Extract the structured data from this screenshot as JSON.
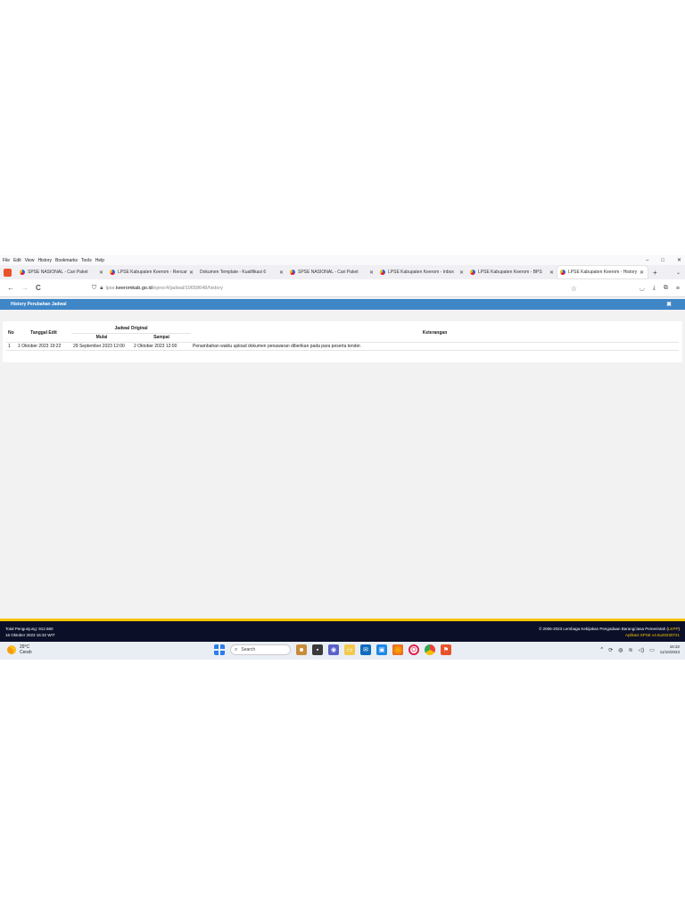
{
  "menubar": {
    "items": [
      "File",
      "Edit",
      "View",
      "History",
      "Bookmarks",
      "Tools",
      "Help"
    ]
  },
  "window_controls": {
    "minimize": "–",
    "maximize": "□",
    "close": "✕"
  },
  "tabs": [
    {
      "title": "SPSE NASIONAL - Cari Paket"
    },
    {
      "title": "LPSE Kabupaten Keerom - Rencana"
    },
    {
      "title": "Dokumen Template - Kualifikasi 6"
    },
    {
      "title": "SPSE NASIONAL - Cari Paket"
    },
    {
      "title": "LPSE Kabupaten Keerom - Inbox"
    },
    {
      "title": "LPSE Kabupaten Keerom - BPS"
    },
    {
      "title": "LPSE Kabupaten Keerom - History"
    }
  ],
  "tab_close": "✕",
  "new_tab": "+",
  "tab_list": "⌄",
  "nav": {
    "back": "←",
    "forward": "→",
    "reload": "C"
  },
  "url": {
    "prefix": "lpse.",
    "host": "keeromkab.go.id",
    "path": "/eproc4/jadwal/10658648/history"
  },
  "dialog": {
    "title": "History Perubahan Jadwal",
    "close": "✖"
  },
  "table": {
    "headers": {
      "no": "No",
      "tanggal_edit": "Tanggal Edit",
      "jadwal_original": "Jadwal Original",
      "mulai": "Mulai",
      "sampai": "Sampai",
      "keterangan": "Keterangan"
    },
    "rows": [
      {
        "no": "1",
        "tanggal_edit": "1 Oktober 2023 19:22",
        "mulai": "29 September 2023 12:00",
        "sampai": "2 Oktober 2023 12:00",
        "keterangan": "Penambahan waktu upload dokumen penawaran diberikan pada para peserta tender."
      }
    ]
  },
  "footer": {
    "left_line1": "Total Pengunjung: 912.560",
    "left_line2": "16 Oktober 2023 16:32 WIT",
    "right_line1_prefix": "© 2006-2023 Lembaga Kebijakan Pengadaan Barang/Jasa Pemerintah (",
    "right_line1_link": "LKPP",
    "right_line1_suffix": ")",
    "right_line2": "Aplikasi SPSE v4.5u20230721"
  },
  "taskbar": {
    "weather_temp": "29°C",
    "weather_desc": "Cerah",
    "search_placeholder": "Search",
    "time": "16:32",
    "date": "11/10/2023"
  },
  "colors": {
    "dialog_bar": "#3f86c7",
    "footer_bg": "#0b0f28",
    "footer_accent": "#f5c400"
  }
}
